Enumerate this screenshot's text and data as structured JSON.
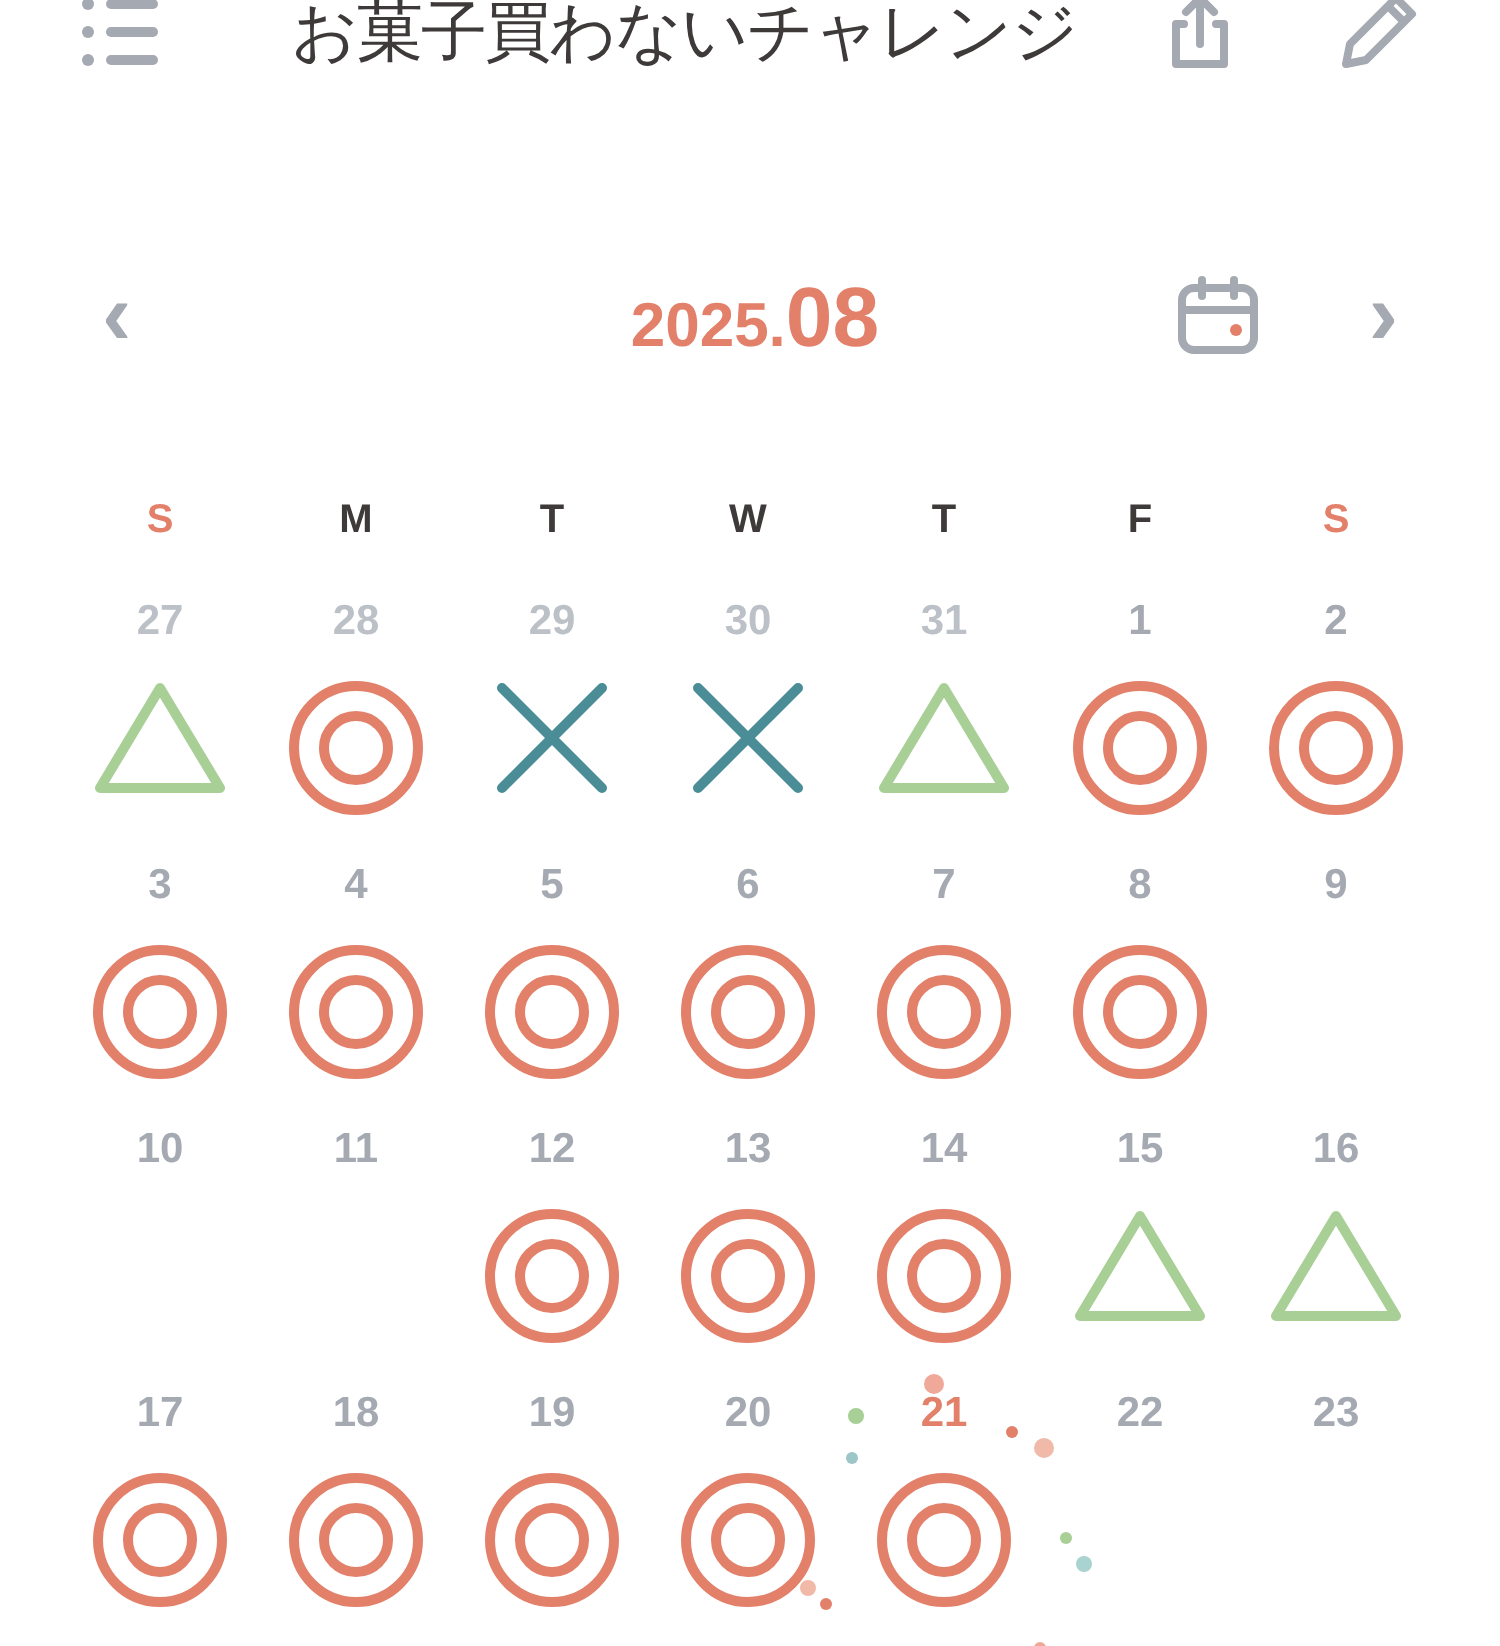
{
  "header": {
    "title": "お菓子買わないチャレンジ"
  },
  "month_nav": {
    "year": "2025.",
    "month": "08",
    "prev": "‹",
    "next": "›"
  },
  "weekdays": [
    {
      "label": "S",
      "weekend": true
    },
    {
      "label": "M",
      "weekend": false
    },
    {
      "label": "T",
      "weekend": false
    },
    {
      "label": "W",
      "weekend": false
    },
    {
      "label": "T",
      "weekend": false
    },
    {
      "label": "F",
      "weekend": false
    },
    {
      "label": "S",
      "weekend": true
    }
  ],
  "days": [
    {
      "date": "27",
      "other_month": true,
      "today": false,
      "kind": "triangle"
    },
    {
      "date": "28",
      "other_month": true,
      "today": false,
      "kind": "double-circle"
    },
    {
      "date": "29",
      "other_month": true,
      "today": false,
      "kind": "cross"
    },
    {
      "date": "30",
      "other_month": true,
      "today": false,
      "kind": "cross"
    },
    {
      "date": "31",
      "other_month": true,
      "today": false,
      "kind": "triangle"
    },
    {
      "date": "1",
      "other_month": false,
      "today": false,
      "kind": "double-circle"
    },
    {
      "date": "2",
      "other_month": false,
      "today": false,
      "kind": "double-circle"
    },
    {
      "date": "3",
      "other_month": false,
      "today": false,
      "kind": "double-circle"
    },
    {
      "date": "4",
      "other_month": false,
      "today": false,
      "kind": "double-circle"
    },
    {
      "date": "5",
      "other_month": false,
      "today": false,
      "kind": "double-circle"
    },
    {
      "date": "6",
      "other_month": false,
      "today": false,
      "kind": "double-circle"
    },
    {
      "date": "7",
      "other_month": false,
      "today": false,
      "kind": "double-circle"
    },
    {
      "date": "8",
      "other_month": false,
      "today": false,
      "kind": "double-circle"
    },
    {
      "date": "9",
      "other_month": false,
      "today": false,
      "kind": "empty"
    },
    {
      "date": "10",
      "other_month": false,
      "today": false,
      "kind": "empty"
    },
    {
      "date": "11",
      "other_month": false,
      "today": false,
      "kind": "empty"
    },
    {
      "date": "12",
      "other_month": false,
      "today": false,
      "kind": "double-circle"
    },
    {
      "date": "13",
      "other_month": false,
      "today": false,
      "kind": "double-circle"
    },
    {
      "date": "14",
      "other_month": false,
      "today": false,
      "kind": "double-circle"
    },
    {
      "date": "15",
      "other_month": false,
      "today": false,
      "kind": "triangle"
    },
    {
      "date": "16",
      "other_month": false,
      "today": false,
      "kind": "triangle"
    },
    {
      "date": "17",
      "other_month": false,
      "today": false,
      "kind": "double-circle"
    },
    {
      "date": "18",
      "other_month": false,
      "today": false,
      "kind": "double-circle"
    },
    {
      "date": "19",
      "other_month": false,
      "today": false,
      "kind": "double-circle"
    },
    {
      "date": "20",
      "other_month": false,
      "today": false,
      "kind": "double-circle"
    },
    {
      "date": "21",
      "other_month": false,
      "today": true,
      "kind": "double-circle"
    },
    {
      "date": "22",
      "other_month": false,
      "today": false,
      "kind": "empty"
    },
    {
      "date": "23",
      "other_month": false,
      "today": false,
      "kind": "empty"
    }
  ]
}
